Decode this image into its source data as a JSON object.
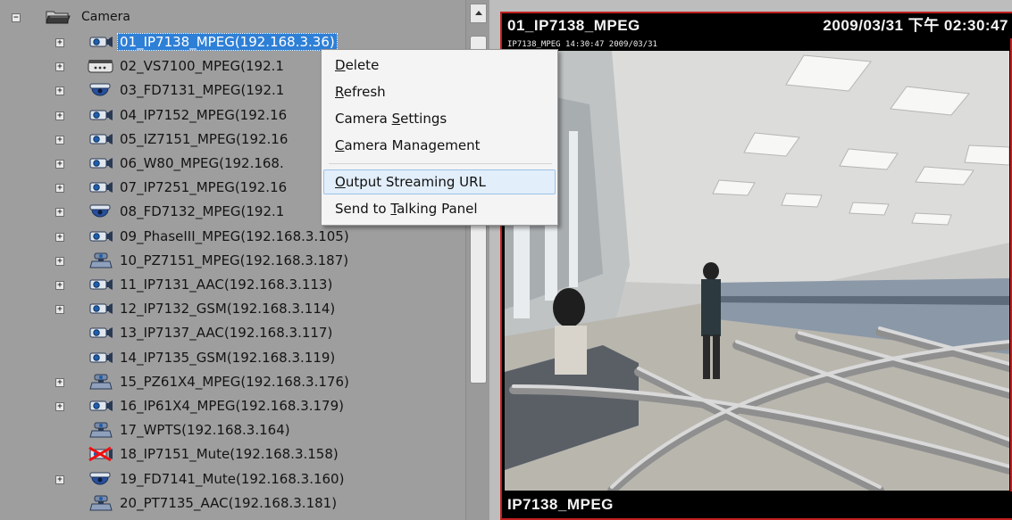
{
  "tree": {
    "root_label": "Camera",
    "items": [
      {
        "label": "01_IP7138_MPEG(192.168.3.36)",
        "icon": "box-camera-icon",
        "expander": true,
        "selected": true
      },
      {
        "label": "02_VS7100_MPEG(192.1",
        "icon": "video-server-icon",
        "expander": true
      },
      {
        "label": "03_FD7131_MPEG(192.1",
        "icon": "dome-camera-icon",
        "expander": true
      },
      {
        "label": "04_IP7152_MPEG(192.16",
        "icon": "box-camera-icon",
        "expander": true
      },
      {
        "label": "05_IZ7151_MPEG(192.16",
        "icon": "box-camera-icon",
        "expander": true
      },
      {
        "label": "06_W80_MPEG(192.168.",
        "icon": "box-camera-icon",
        "expander": true
      },
      {
        "label": "07_IP7251_MPEG(192.16",
        "icon": "box-camera-icon",
        "expander": true
      },
      {
        "label": "08_FD7132_MPEG(192.1",
        "icon": "dome-camera-icon",
        "expander": true
      },
      {
        "label": "09_PhaseIII_MPEG(192.168.3.105)",
        "icon": "box-camera-icon",
        "expander": true
      },
      {
        "label": "10_PZ7151_MPEG(192.168.3.187)",
        "icon": "ptz-camera-icon",
        "expander": true
      },
      {
        "label": "11_IP7131_AAC(192.168.3.113)",
        "icon": "box-camera-icon",
        "expander": true
      },
      {
        "label": "12_IP7132_GSM(192.168.3.114)",
        "icon": "box-camera-icon",
        "expander": true
      },
      {
        "label": "13_IP7137_AAC(192.168.3.117)",
        "icon": "box-camera-icon",
        "expander": false
      },
      {
        "label": "14_IP7135_GSM(192.168.3.119)",
        "icon": "box-camera-icon",
        "expander": false
      },
      {
        "label": "15_PZ61X4_MPEG(192.168.3.176)",
        "icon": "ptz-camera-icon",
        "expander": true
      },
      {
        "label": "16_IP61X4_MPEG(192.168.3.179)",
        "icon": "box-camera-icon",
        "expander": true
      },
      {
        "label": "17_WPTS(192.168.3.164)",
        "icon": "ptz-camera-icon",
        "expander": false
      },
      {
        "label": "18_IP7151_Mute(192.168.3.158)",
        "icon": "disconnected-camera-icon",
        "expander": false
      },
      {
        "label": "19_FD7141_Mute(192.168.3.160)",
        "icon": "dome-camera-icon",
        "expander": true
      },
      {
        "label": "20_PT7135_AAC(192.168.3.181)",
        "icon": "ptz-camera-icon",
        "expander": false
      }
    ]
  },
  "context_menu": {
    "delete": {
      "label": "Delete",
      "access_key": "D"
    },
    "refresh": {
      "label": "Refresh",
      "access_key": "R"
    },
    "camera_settings": {
      "label": "Camera Settings",
      "access_key": "S"
    },
    "camera_management": {
      "label": "Camera Management",
      "access_key": "C"
    },
    "output_streaming_url": {
      "label": "Output Streaming URL",
      "access_key": "O"
    },
    "send_to_talking_panel": {
      "label": "Send to Talking Panel",
      "access_key": "T"
    }
  },
  "video": {
    "title": "01_IP7138_MPEG",
    "timestamp": "2009/03/31 下午 02:30:47",
    "camera_stamp": "IP7138_MPEG 14:30:47 2009/03/31",
    "footer_label": "IP7138_MPEG",
    "border_color": "#c02020"
  },
  "colors": {
    "selection": "#2e7fd6",
    "menu_hover_bg": "#e2eef9",
    "menu_hover_border": "#9cc2e8"
  }
}
